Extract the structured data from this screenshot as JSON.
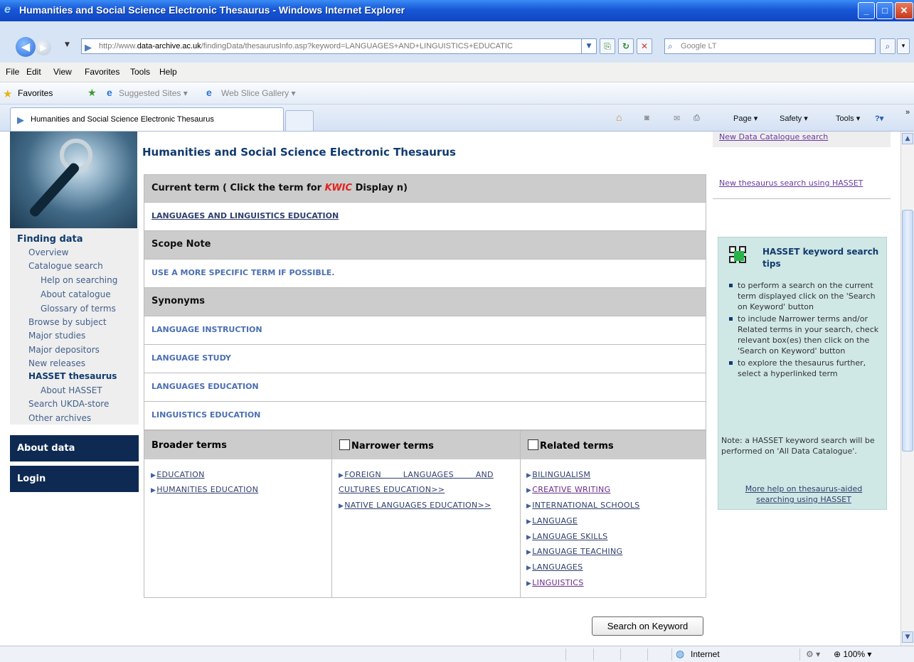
{
  "window": {
    "title": "Humanities and Social Science Electronic Thesaurus - Windows Internet Explorer"
  },
  "address": {
    "url_prefix": "http://www.",
    "url_domain": "data-archive.ac.uk",
    "url_path": "/findingData/thesaurusInfo.asp?keyword=LANGUAGES+AND+LINGUISTICS+EDUCATIC",
    "search_placeholder": "Google LT"
  },
  "menu": [
    "File",
    "Edit",
    "View",
    "Favorites",
    "Tools",
    "Help"
  ],
  "favorites": {
    "label": "Favorites",
    "suggested": "Suggested Sites ▾",
    "webslice": "Web Slice Gallery ▾"
  },
  "tab": {
    "title": "Humanities and Social Science Electronic Thesaurus"
  },
  "commandbar": {
    "page": "Page ▾",
    "safety": "Safety ▾",
    "tools": "Tools ▾"
  },
  "leftnav": {
    "title": "Finding data",
    "items": [
      "Overview",
      "Catalogue search",
      "Help on searching",
      "About catalogue",
      "Glossary of terms",
      "Browse by subject",
      "Major studies",
      "Major depositors",
      "New releases",
      "HASSET thesaurus",
      "About HASSET",
      "Search UKDA-store",
      "Other archives"
    ],
    "about_data": "About data",
    "login": "Login"
  },
  "main": {
    "page_title": "Humanities and Social Science Electronic Thesaurus",
    "current_term_header_pre": "Current term ( Click the term for ",
    "current_term_header_kwic": "KWIC",
    "current_term_header_post": " Display n)",
    "current_term": "LANGUAGES AND LINGUISTICS EDUCATION",
    "scope_note_header": "Scope Note",
    "scope_note": "USE A MORE SPECIFIC TERM IF POSSIBLE.",
    "synonyms_header": "Synonyms",
    "synonyms": [
      "LANGUAGE INSTRUCTION",
      "LANGUAGE STUDY",
      "LANGUAGES EDUCATION",
      "LINGUISTICS EDUCATION"
    ],
    "broader_header": "Broader terms",
    "narrower_header": "Narrower terms",
    "related_header": "Related terms",
    "broader": [
      "EDUCATION",
      "HUMANITIES EDUCATION"
    ],
    "narrower": [
      "FOREIGN LANGUAGES AND",
      "CULTURES EDUCATION>>",
      "NATIVE LANGUAGES EDUCATION>>"
    ],
    "related": [
      "BILINGUALISM",
      "CREATIVE WRITING",
      "INTERNATIONAL SCHOOLS",
      "LANGUAGE",
      "LANGUAGE SKILLS",
      "LANGUAGE TEACHING",
      "LANGUAGES",
      "LINGUISTICS"
    ],
    "search_button": "Search on Keyword"
  },
  "right": {
    "new_catalogue_search": "New Data Catalogue search",
    "new_thesaurus_search": "New thesaurus search using HASSET",
    "tips_title": "HASSET keyword search tips",
    "tips": [
      "to perform a search on the current term displayed click on the 'Search on Keyword' button",
      "to include Narrower terms and/or Related terms in your search, check relevant box(es) then click on the 'Search on Keyword' button",
      "to explore the thesaurus further, select a hyperlinked term"
    ],
    "note": "Note: a HASSET keyword search will be performed on 'All Data Catalogue'.",
    "more_help": "More help on thesaurus-aided searching using HASSET"
  },
  "status": {
    "zone": "Internet",
    "zoom": "100%"
  }
}
